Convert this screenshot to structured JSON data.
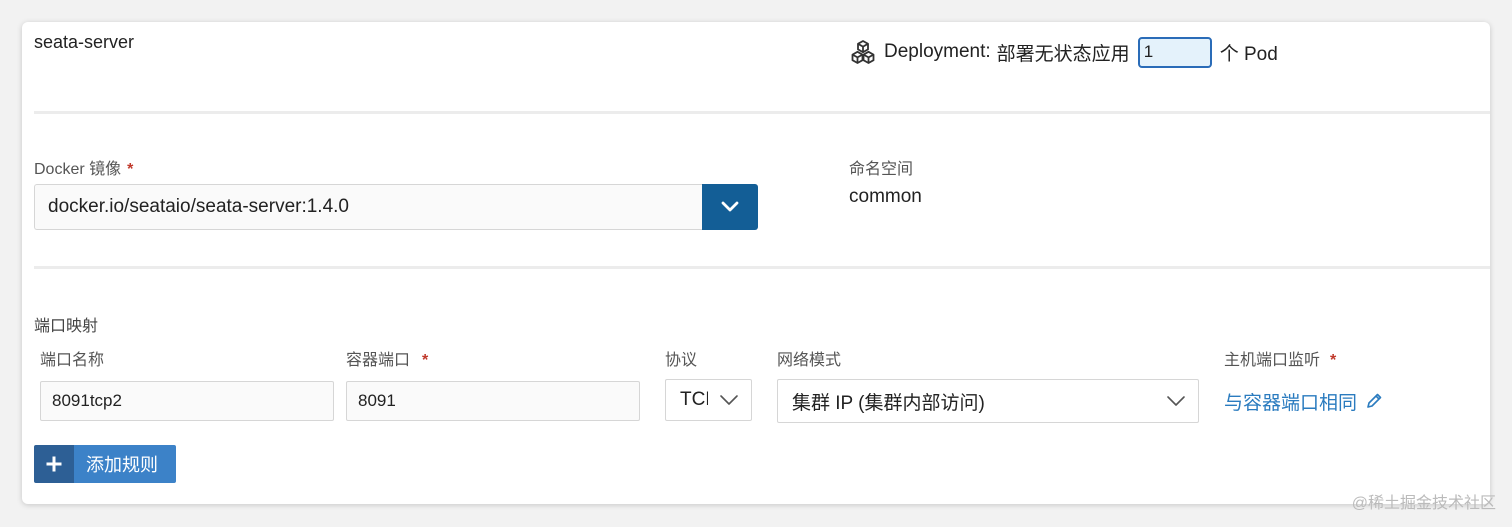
{
  "workload": {
    "name": "seata-server",
    "type_label": "Deployment:",
    "type_desc": "部署无状态应用",
    "replicas": "1",
    "replicas_suffix": "个 Pod"
  },
  "image": {
    "label": "Docker 镜像",
    "required_mark": "*",
    "value": "docker.io/seataio/seata-server:1.4.0"
  },
  "namespace": {
    "label": "命名空间",
    "value": "common"
  },
  "ports": {
    "section_title": "端口映射",
    "headers": {
      "name": "端口名称",
      "container_port": "容器端口",
      "protocol": "协议",
      "network_mode": "网络模式",
      "host_port": "主机端口监听"
    },
    "required_mark": "*",
    "row": {
      "name": "8091tcp2",
      "container_port": "8091",
      "protocol": "TCP",
      "network_mode": "集群 IP (集群内部访问)",
      "host_port": "与容器端口相同"
    },
    "add_button": "添加规则"
  },
  "watermark": "@稀土掘金技术社区",
  "colors": {
    "primary_dark": "#135e96",
    "primary": "#3c82c8",
    "link": "#2a7bbf",
    "required": "#c0392b"
  },
  "icons": [
    "cubes-icon",
    "chevron-down-icon",
    "pencil-icon",
    "plus-icon"
  ]
}
